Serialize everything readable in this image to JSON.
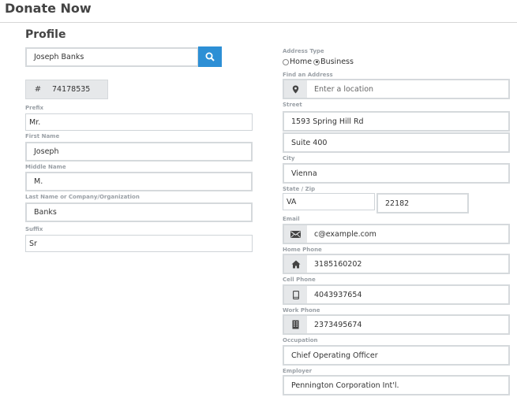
{
  "page": {
    "title": "Donate Now"
  },
  "profile": {
    "title": "Profile",
    "search_value": "Joseph Banks",
    "id_symbol": "#",
    "id_value": "74178535",
    "prefix": {
      "label": "Prefix",
      "value": "Mr."
    },
    "first_name": {
      "label": "First Name",
      "value": "Joseph"
    },
    "middle_name": {
      "label": "Middle Name",
      "value": "M."
    },
    "last_name": {
      "label": "Last Name or Company/Organization",
      "value": "Banks"
    },
    "suffix": {
      "label": "Suffix",
      "value": "Sr"
    }
  },
  "address": {
    "type_label": "Address Type",
    "type_options": [
      "Home",
      "Business"
    ],
    "type_selected": "Business",
    "find_label": "Find an Address",
    "find_placeholder": "Enter a location",
    "street_label": "Street",
    "street1": "1593 Spring Hill Rd",
    "street2": "Suite 400",
    "city_label": "City",
    "city": "Vienna",
    "state_zip_label": "State / Zip",
    "state": "VA",
    "zip": "22182"
  },
  "contact": {
    "email_label": "Email",
    "email": "c@example.com",
    "home_phone_label": "Home Phone",
    "home_phone": "3185160202",
    "cell_phone_label": "Cell Phone",
    "cell_phone": "4043937654",
    "work_phone_label": "Work Phone",
    "work_phone": "2373495674"
  },
  "employment": {
    "occupation_label": "Occupation",
    "occupation": "Chief Operating Officer",
    "employer_label": "Employer",
    "employer": "Pennington Corporation Int'l."
  },
  "icons": {
    "search": "search-icon",
    "location": "location-pin-icon",
    "email": "envelope-icon",
    "home": "house-icon",
    "cell": "mobile-phone-icon",
    "work": "office-building-icon"
  },
  "colors": {
    "accent": "#2d8fd5",
    "addon_bg": "#e6e8ea",
    "label": "#9aa0a6"
  }
}
